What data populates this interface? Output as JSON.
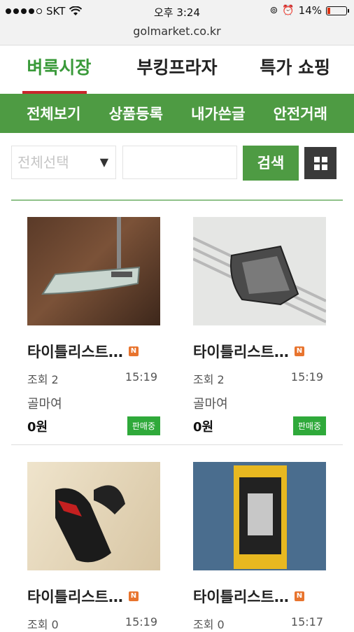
{
  "status": {
    "carrier": "SKT",
    "time": "오후 3:24",
    "battery": "14%",
    "battery_level": 0.14
  },
  "url": "golmarket.co.kr",
  "tabs": [
    "벼룩시장",
    "부킹프라자",
    "특가 쇼핑"
  ],
  "subnav": [
    "전체보기",
    "상품등록",
    "내가쓴글",
    "안전거래"
  ],
  "search": {
    "select_value": "전체선택",
    "button": "검색"
  },
  "items": [
    {
      "title": "타이틀리스트…",
      "views": "조회 2",
      "time": "15:19",
      "seller": "골마여",
      "price": "0원",
      "status": "판매중"
    },
    {
      "title": "타이틀리스트…",
      "views": "조회 2",
      "time": "15:19",
      "seller": "골마여",
      "price": "0원",
      "status": "판매중"
    },
    {
      "title": "타이틀리스트…",
      "views": "조회 0",
      "time": "15:19"
    },
    {
      "title": "타이틀리스트…",
      "views": "조회 0",
      "time": "15:17"
    }
  ],
  "new_tag": "N"
}
